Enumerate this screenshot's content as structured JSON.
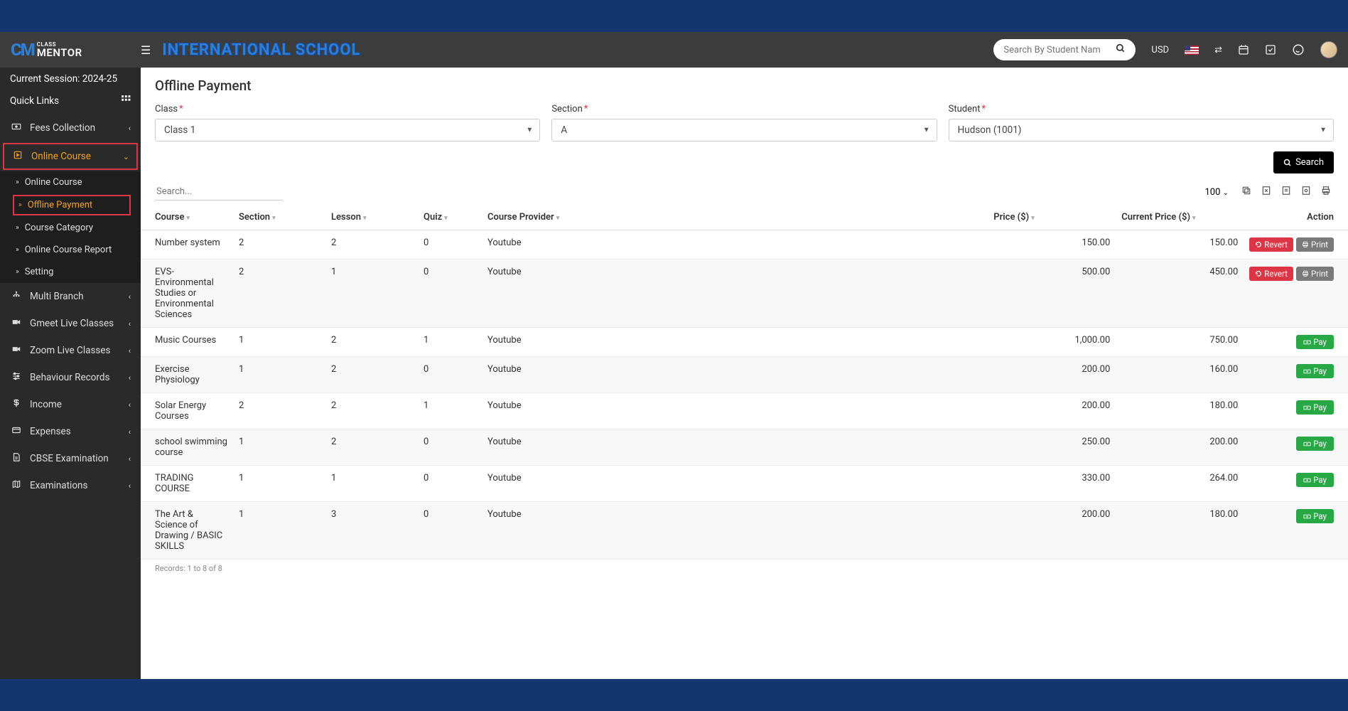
{
  "header": {
    "logo_top": "CLASS",
    "logo_bottom": "MENTOR",
    "school_title": "INTERNATIONAL SCHOOL",
    "search_placeholder": "Search By Student Nam",
    "currency": "USD"
  },
  "sidebar": {
    "session": "Current Session: 2024-25",
    "quick_links": "Quick Links",
    "items": [
      {
        "icon": "money-icon",
        "label": "Fees Collection",
        "chevron": "‹"
      },
      {
        "icon": "course-icon",
        "label": "Online Course",
        "chevron": "⌄",
        "highlighted": true,
        "open": true,
        "sub": [
          {
            "label": "Online Course"
          },
          {
            "label": "Offline Payment",
            "active_sub": true
          },
          {
            "label": "Course Category"
          },
          {
            "label": "Online Course Report"
          },
          {
            "label": "Setting"
          }
        ]
      },
      {
        "icon": "branch-icon",
        "label": "Multi Branch",
        "chevron": "‹"
      },
      {
        "icon": "video-icon",
        "label": "Gmeet Live Classes",
        "chevron": "‹"
      },
      {
        "icon": "video-icon",
        "label": "Zoom Live Classes",
        "chevron": "‹"
      },
      {
        "icon": "behaviour-icon",
        "label": "Behaviour Records",
        "chevron": "‹"
      },
      {
        "icon": "dollar-icon",
        "label": "Income",
        "chevron": "‹"
      },
      {
        "icon": "card-icon",
        "label": "Expenses",
        "chevron": "‹"
      },
      {
        "icon": "doc-icon",
        "label": "CBSE Examination",
        "chevron": "‹"
      },
      {
        "icon": "map-icon",
        "label": "Examinations",
        "chevron": "‹"
      }
    ]
  },
  "page": {
    "title": "Offline Payment",
    "filters": {
      "class_label": "Class",
      "class_value": "Class 1",
      "section_label": "Section",
      "section_value": "A",
      "student_label": "Student",
      "student_value": "Hudson (1001)"
    },
    "search_btn": "Search",
    "table_search_placeholder": "Search...",
    "page_size": "100",
    "columns": {
      "course": "Course",
      "section": "Section",
      "lesson": "Lesson",
      "quiz": "Quiz",
      "provider": "Course Provider",
      "price": "Price ($)",
      "cprice": "Current Price ($)",
      "action": "Action"
    },
    "rows": [
      {
        "course": "Number system",
        "section": "2",
        "lesson": "2",
        "quiz": "0",
        "provider": "Youtube",
        "price": "150.00",
        "cprice": "150.00",
        "action": "revert_print"
      },
      {
        "course": "EVS-Environmental Studies or Environmental Sciences",
        "section": "2",
        "lesson": "1",
        "quiz": "0",
        "provider": "Youtube",
        "price": "500.00",
        "cprice": "450.00",
        "action": "revert_print"
      },
      {
        "course": "Music Courses",
        "section": "1",
        "lesson": "2",
        "quiz": "1",
        "provider": "Youtube",
        "price": "1,000.00",
        "cprice": "750.00",
        "action": "pay"
      },
      {
        "course": "Exercise Physiology",
        "section": "1",
        "lesson": "2",
        "quiz": "0",
        "provider": "Youtube",
        "price": "200.00",
        "cprice": "160.00",
        "action": "pay"
      },
      {
        "course": "Solar Energy Courses",
        "section": "2",
        "lesson": "2",
        "quiz": "1",
        "provider": "Youtube",
        "price": "200.00",
        "cprice": "180.00",
        "action": "pay"
      },
      {
        "course": "school swimming course",
        "section": "1",
        "lesson": "2",
        "quiz": "0",
        "provider": "Youtube",
        "price": "250.00",
        "cprice": "200.00",
        "action": "pay"
      },
      {
        "course": "TRADING COURSE",
        "section": "1",
        "lesson": "1",
        "quiz": "0",
        "provider": "Youtube",
        "price": "330.00",
        "cprice": "264.00",
        "action": "pay"
      },
      {
        "course": "The Art & Science of Drawing / BASIC SKILLS",
        "section": "1",
        "lesson": "3",
        "quiz": "0",
        "provider": "Youtube",
        "price": "200.00",
        "cprice": "180.00",
        "action": "pay"
      }
    ],
    "btn_revert": "Revert",
    "btn_print": "Print",
    "btn_pay": "Pay",
    "records_text": "Records: 1 to 8 of 8"
  }
}
